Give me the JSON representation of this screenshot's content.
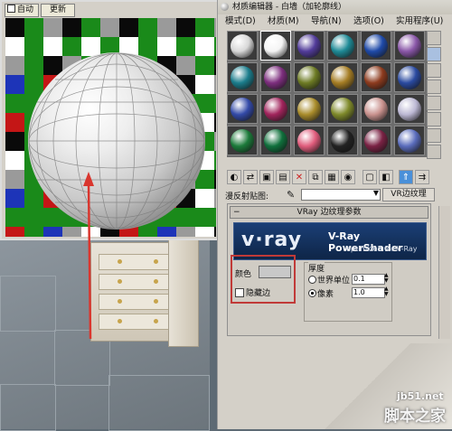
{
  "preview": {
    "tabs": [
      "自动",
      "更新"
    ],
    "checker_colors": [
      "#0a0a0a",
      "#c41616",
      "#1a8a1a",
      "#1d34b8",
      "#9a9a9a",
      "#ffffff"
    ]
  },
  "editor": {
    "title": "材质编辑器 - 白墙（加轮廓线）",
    "menu": [
      "模式(D)",
      "材质(M)",
      "导航(N)",
      "选项(O)",
      "实用程序(U)"
    ],
    "slot_colors": [
      "#d8d8d8",
      "#f4f4f4",
      "#523c9a",
      "#1e8a96",
      "#1f4aa8",
      "#8a57a8",
      "#1b7d8c",
      "#7d2e7e",
      "#6d7b24",
      "#a57d24",
      "#8d3b1e",
      "#2a4aa0",
      "#334aa8",
      "#a1245c",
      "#a98c2b",
      "#7f8a2a",
      "#c9928e",
      "#bcb8d4",
      "#1c7a3a",
      "#10703c",
      "#e05c7c",
      "#222222",
      "#7a2244",
      "#5a6cbc"
    ],
    "map_label": "漫反射贴图:",
    "map_name": "VR边纹理",
    "rollout_title": "VRay 边纹理参数",
    "banner_logo": "v·ray",
    "banner_title": "V-Ray PowerShader",
    "banner_sub": "optimized for V-Ray",
    "color_label": "颜色",
    "hidden_edges_label": "隐藏边",
    "thickness_label": "厚度",
    "world_units_label": "世界单位",
    "world_units_value": "0.1",
    "pixels_label": "像素",
    "pixels_value": "1.0"
  },
  "watermark": {
    "site": "jb51.net",
    "name": "脚本之家"
  }
}
